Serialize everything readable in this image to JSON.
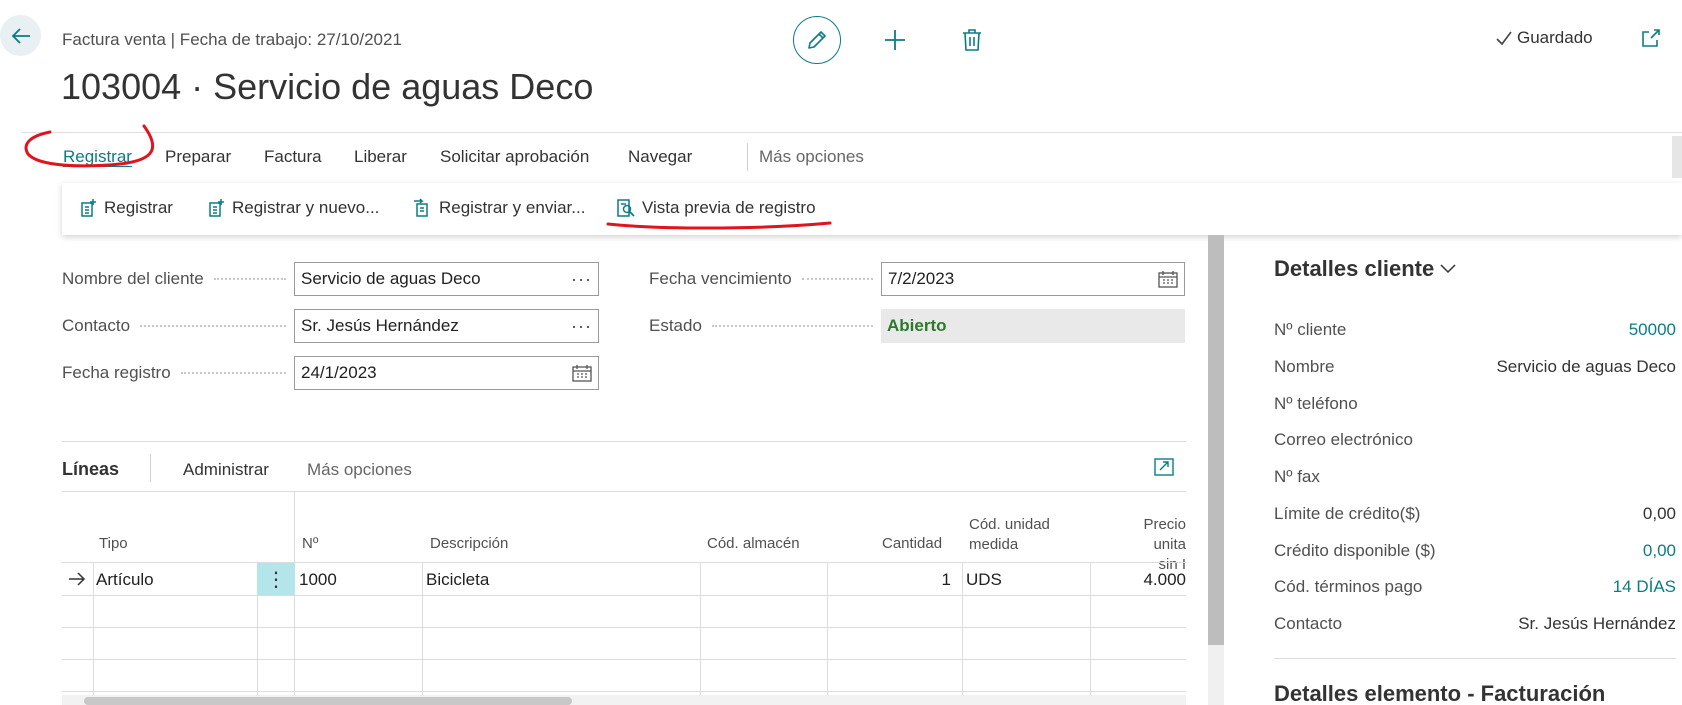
{
  "header": {
    "caption": "Factura venta | Fecha de trabajo: 27/10/2021",
    "title": "103004 · Servicio de aguas Deco",
    "saved_label": "Guardado"
  },
  "menu": {
    "items": [
      "Registrar",
      "Preparar",
      "Factura",
      "Liberar",
      "Solicitar aprobación",
      "Navegar"
    ],
    "active": "Registrar",
    "more": "Más opciones"
  },
  "actions": [
    "Registrar",
    "Registrar y nuevo...",
    "Registrar y enviar...",
    "Vista previa de registro"
  ],
  "form": {
    "customer_name_label": "Nombre del cliente",
    "customer_name": "Servicio de aguas Deco",
    "contact_label": "Contacto",
    "contact": "Sr. Jesús Hernández",
    "posting_date_label": "Fecha registro",
    "posting_date": "24/1/2023",
    "due_date_label": "Fecha vencimiento",
    "due_date": "7/2/2023",
    "status_label": "Estado",
    "status": "Abierto"
  },
  "lines": {
    "title": "Líneas",
    "manage": "Administrar",
    "more": "Más opciones",
    "columns": {
      "type": "Tipo",
      "no": "Nº",
      "description": "Descripción",
      "location": "Cód. almacén",
      "quantity": "Cantidad",
      "uom_1": "Cód. unidad",
      "uom_2": "medida",
      "price_1": "Precio unita",
      "price_2": "sin I"
    },
    "rows": [
      {
        "type": "Artículo",
        "no": "1000",
        "description": "Bicicleta",
        "location": "",
        "quantity": "1",
        "uom": "UDS",
        "price": "4.000"
      }
    ]
  },
  "factbox": {
    "title": "Detalles cliente",
    "rows": [
      {
        "label": "Nº cliente",
        "value": "50000"
      },
      {
        "label": "Nombre",
        "value": "Servicio de aguas Deco"
      },
      {
        "label": "Nº teléfono",
        "value": ""
      },
      {
        "label": "Correo electrónico",
        "value": ""
      },
      {
        "label": "Nº fax",
        "value": ""
      },
      {
        "label": "Límite de crédito($)",
        "value": "0,00"
      },
      {
        "label": "Crédito disponible ($)",
        "value": "0,00"
      },
      {
        "label": "Cód. términos pago",
        "value": "14 DÍAS"
      },
      {
        "label": "Contacto",
        "value": "Sr. Jesús Hernández"
      }
    ],
    "title2": "Detalles elemento - Facturación"
  },
  "colors": {
    "accent": "#0b7c86",
    "status_open": "#2b7a2b",
    "annotation": "#e0141e"
  }
}
